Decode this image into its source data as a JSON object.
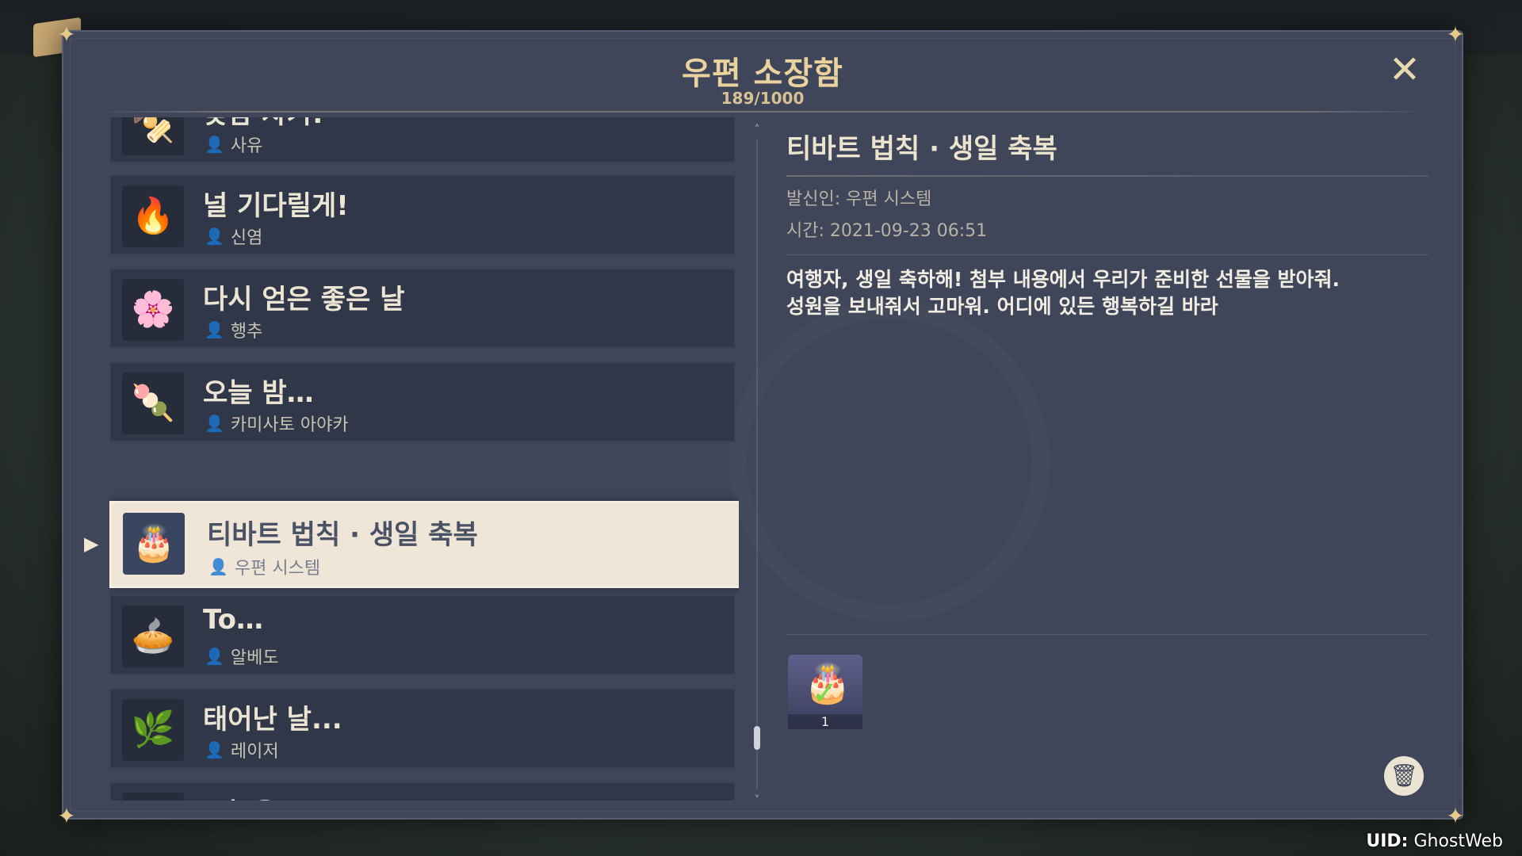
{
  "window": {
    "title": "우편 소장함",
    "count": "189/1000"
  },
  "mails": [
    {
      "title": "낮잠 자기!",
      "sender": "사유",
      "icon": "tofu-icon",
      "glyph": "🍢"
    },
    {
      "title": "널 기다릴게!",
      "sender": "신염",
      "icon": "hotpot-icon",
      "glyph": "🔥"
    },
    {
      "title": "다시 얻은 좋은 날",
      "sender": "행추",
      "icon": "flower-icon",
      "glyph": "🌸"
    },
    {
      "title": "오늘 밤…",
      "sender": "카미사토 아야카",
      "icon": "sweets-icon",
      "glyph": "🍡"
    },
    {
      "title": "티바트 법칙 · 생일 축복",
      "sender": "우편 시스템",
      "icon": "cake-icon",
      "glyph": "🎂",
      "selected": true
    },
    {
      "title": "To…",
      "sender": "알베도",
      "icon": "pie-icon",
      "glyph": "🥧"
    },
    {
      "title": "태어난 날...",
      "sender": "레이저",
      "icon": "lily-icon",
      "glyph": "🌿"
    },
    {
      "title": "오늘은…",
      "sender": "",
      "icon": "flower-icon",
      "glyph": "🌸"
    }
  ],
  "detail": {
    "title": "티바트 법칙 · 생일 축복",
    "sender": "발신인: 우편 시스템",
    "time": "시간: 2021-09-23 06:51",
    "body_line1": "여행자, 생일 축하해! 첨부 내용에서 우리가 준비한 선물을 받아줘.",
    "body_line2": "성원을 보내줘서 고마워. 어디에 있든 행복하길 바라",
    "attachment": {
      "icon": "cake-icon",
      "glyph": "🎂",
      "quantity": "1",
      "claimed": true
    }
  },
  "footer": {
    "uid_label": "UID:",
    "uid_value": "GhostWeb"
  },
  "colors": {
    "panel": "#3f4659",
    "card": "#2f3749",
    "selected_card": "#efe6d8",
    "title_gold": "#e9d29e"
  }
}
